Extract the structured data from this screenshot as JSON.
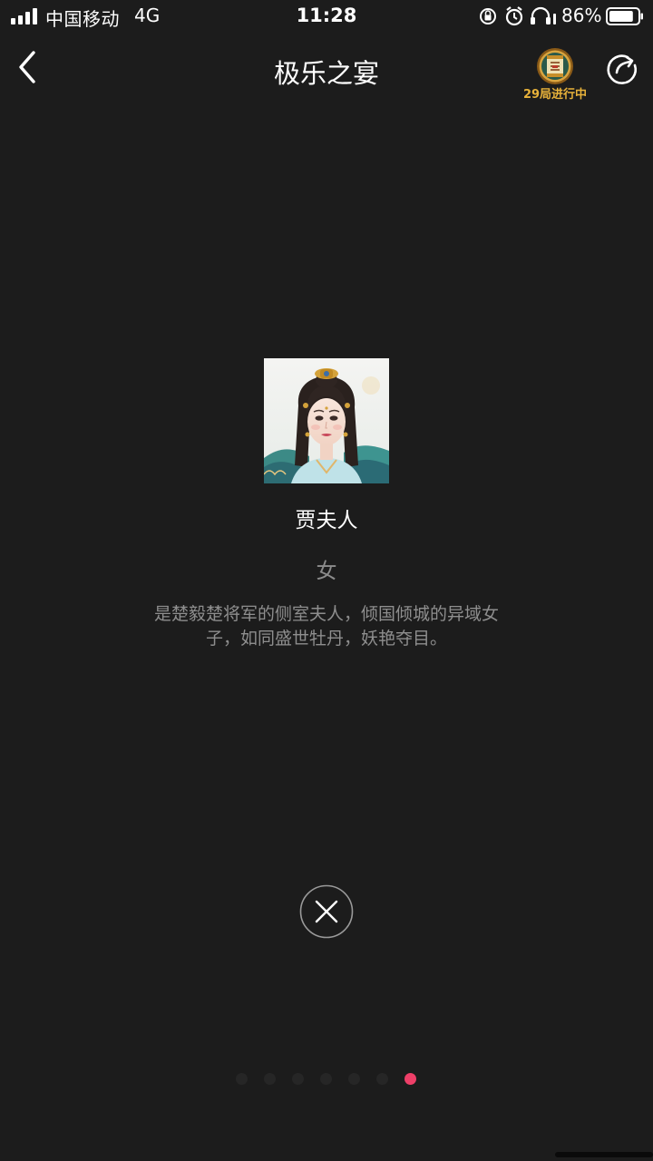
{
  "status_bar": {
    "carrier": "中国移动",
    "network": "4G",
    "time": "11:28",
    "battery_percent": "86%",
    "battery_level": 0.86,
    "icons": [
      "rotation-lock-icon",
      "alarm-icon",
      "headphones-icon"
    ]
  },
  "nav": {
    "back_icon": "chevron-left-icon",
    "title": "极乐之宴",
    "game_badge_label": "29局进行中",
    "share_icon": "share-arrow-icon"
  },
  "character": {
    "name": "贾夫人",
    "gender": "女",
    "description": "是楚毅楚将军的侧室夫人，倾国倾城的异域女子，如同盛世牡丹，妖艳夺目。"
  },
  "close_icon": "close-icon",
  "pager": {
    "total": 7,
    "current": 7
  },
  "colors": {
    "background": "#1c1c1c",
    "accent": "#ee3f68",
    "badge_text": "#e8b23a"
  }
}
